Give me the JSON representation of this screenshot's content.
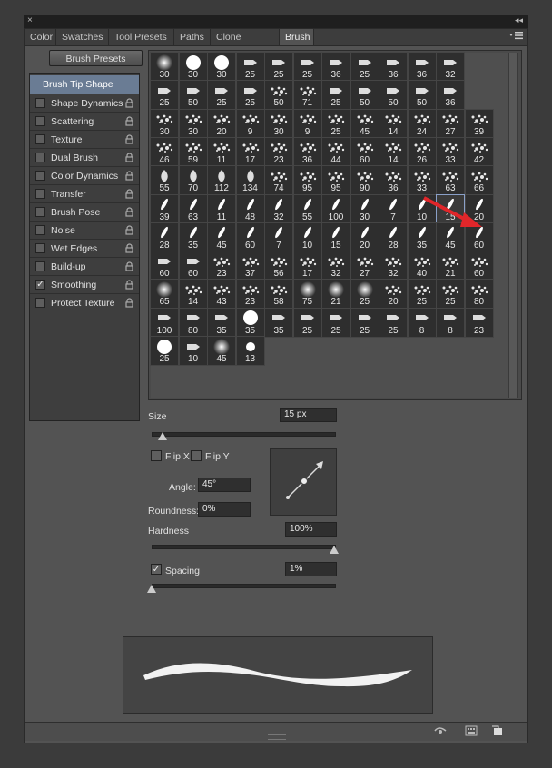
{
  "window": {
    "close_label": "×",
    "collapse_label": "◂◂"
  },
  "tabs": [
    {
      "label": "Color",
      "active": false
    },
    {
      "label": "Swatches",
      "active": false
    },
    {
      "label": "Tool Presets",
      "active": false
    },
    {
      "label": "Paths",
      "active": false
    },
    {
      "label": "Clone Source",
      "active": false
    },
    {
      "label": "Brush",
      "active": true
    }
  ],
  "panel_menu_icon": "panel-menu-icon",
  "brush_presets_button": "Brush Presets",
  "sidebar": {
    "title": "Brush Tip Shape",
    "items": [
      {
        "label": "Shape Dynamics",
        "checked": false,
        "locked": true
      },
      {
        "label": "Scattering",
        "checked": false,
        "locked": true
      },
      {
        "label": "Texture",
        "checked": false,
        "locked": true
      },
      {
        "label": "Dual Brush",
        "checked": false,
        "locked": true
      },
      {
        "label": "Color Dynamics",
        "checked": false,
        "locked": true
      },
      {
        "label": "Transfer",
        "checked": false,
        "locked": true
      },
      {
        "label": "Brush Pose",
        "checked": false,
        "locked": true
      },
      {
        "label": "Noise",
        "checked": false,
        "locked": true
      },
      {
        "label": "Wet Edges",
        "checked": false,
        "locked": true
      },
      {
        "label": "Build-up",
        "checked": false,
        "locked": true
      },
      {
        "label": "Smoothing",
        "checked": true,
        "locked": true
      },
      {
        "label": "Protect Texture",
        "checked": false,
        "locked": true
      }
    ]
  },
  "brush_grid": {
    "rows": [
      [
        "30",
        "30",
        "30",
        "25",
        "25",
        "25",
        "36",
        "25",
        "36",
        "36",
        "32"
      ],
      [
        "25",
        "50",
        "25",
        "25",
        "50",
        "71",
        "25",
        "50",
        "50",
        "50",
        "36"
      ],
      [
        "30",
        "30",
        "20",
        "9",
        "30",
        "9",
        "25",
        "45",
        "14",
        "24",
        "27",
        "39"
      ],
      [
        "46",
        "59",
        "11",
        "17",
        "23",
        "36",
        "44",
        "60",
        "14",
        "26",
        "33",
        "42"
      ],
      [
        "55",
        "70",
        "112",
        "134",
        "74",
        "95",
        "95",
        "90",
        "36",
        "33",
        "63",
        "66"
      ],
      [
        "39",
        "63",
        "11",
        "48",
        "32",
        "55",
        "100",
        "30",
        "7",
        "10",
        "15",
        "20"
      ],
      [
        "28",
        "35",
        "45",
        "60",
        "7",
        "10",
        "15",
        "20",
        "28",
        "35",
        "45",
        "60"
      ],
      [
        "60",
        "60",
        "23",
        "37",
        "56",
        "17",
        "32",
        "27",
        "32",
        "40",
        "21",
        "60"
      ],
      [
        "65",
        "14",
        "43",
        "23",
        "58",
        "75",
        "21",
        "25",
        "20",
        "25",
        "25",
        "80"
      ],
      [
        "100",
        "80",
        "35",
        "35",
        "35",
        "25",
        "25",
        "25",
        "25",
        "8",
        "8",
        "23"
      ],
      [
        "25",
        "10",
        "45",
        "13"
      ]
    ],
    "selected": {
      "row": 5,
      "col": 10
    }
  },
  "controls": {
    "size_label": "Size",
    "size_value": "15 px",
    "size_fraction": 0.06,
    "flip_x_label": "Flip X",
    "flip_y_label": "Flip Y",
    "flip_x": false,
    "flip_y": false,
    "angle_label": "Angle:",
    "angle_value": "45°",
    "roundness_label": "Roundness:",
    "roundness_value": "0%",
    "hardness_label": "Hardness",
    "hardness_value": "100%",
    "hardness_fraction": 1.0,
    "spacing_label": "Spacing",
    "spacing_checked": true,
    "spacing_value": "1%",
    "spacing_fraction": 0.0
  },
  "bottom_icons": [
    "create-new-brush-icon",
    "toggle-bristle-preview-icon",
    "new-brush-icon"
  ],
  "colors": {
    "panel": "#535353",
    "selected_sidebar": "#6a7c94",
    "annotation_arrow": "#e0262a"
  }
}
